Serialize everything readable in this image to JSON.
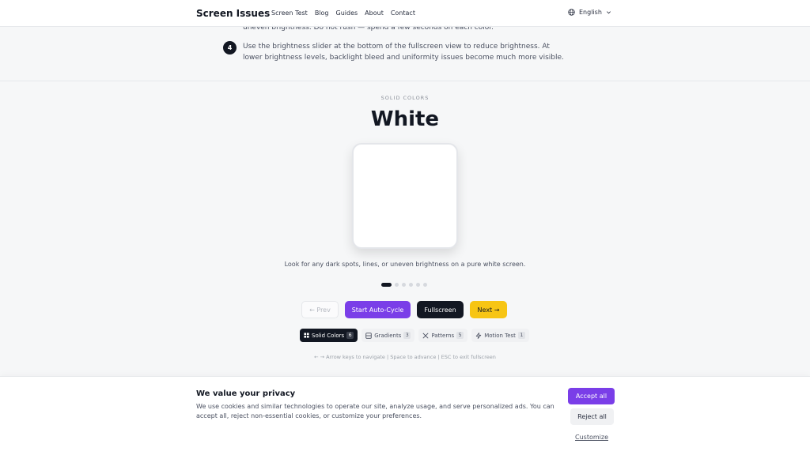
{
  "header": {
    "brand": "Screen Issues",
    "nav": [
      "Screen Test",
      "Blog",
      "Guides",
      "About",
      "Contact"
    ],
    "language": "English"
  },
  "instructions": {
    "prev_text": "uneven brightness. Do not rush — spend a few seconds on each color.",
    "step_number": "4",
    "step_text": "Use the brightness slider at the bottom of the fullscreen view to reduce brightness. At lower brightness levels, backlight bleed and uniformity issues become much more visible."
  },
  "test": {
    "eyebrow": "SOLID COLORS",
    "color_name": "White",
    "color_hex": "#ffffff",
    "description": "Look for any dark spots, lines, or uneven brightness on a pure white screen.",
    "dots_total": 6,
    "dots_active": 0,
    "buttons": {
      "prev": "← Prev",
      "auto": "Start Auto-Cycle",
      "fullscreen": "Fullscreen",
      "next": "Next →"
    },
    "categories": [
      {
        "label": "Solid Colors",
        "count": "6",
        "icon": "grid-icon"
      },
      {
        "label": "Gradients",
        "count": "3",
        "icon": "gradient-icon"
      },
      {
        "label": "Patterns",
        "count": "5",
        "icon": "pattern-icon"
      },
      {
        "label": "Motion Test",
        "count": "1",
        "icon": "motion-icon"
      }
    ],
    "hint": "← → Arrow keys to navigate | Space to advance | ESC to exit fullscreen"
  },
  "cookie": {
    "title": "We value your privacy",
    "text": "We use cookies and similar technologies to operate our site, analyze usage, and serve personalized ads. You can accept all, reject non-essential cookies, or customize your preferences.",
    "accept": "Accept all",
    "reject": "Reject all",
    "customize": "Customize"
  },
  "colors": {
    "accent": "#7a3ee8",
    "dark": "#121722",
    "yellow": "#f7c514"
  }
}
